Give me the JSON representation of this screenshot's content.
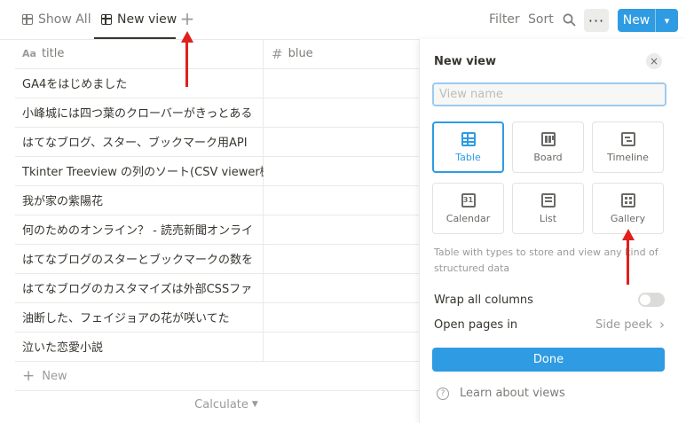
{
  "tabs": {
    "show_all": "Show All",
    "new_view": "New view",
    "add": "+"
  },
  "toolbar": {
    "filter": "Filter",
    "sort": "Sort",
    "more": "···",
    "new": "New"
  },
  "table": {
    "columns": [
      {
        "icon": "Aa",
        "label": "title"
      },
      {
        "icon": "#",
        "label": "blue"
      }
    ],
    "rows": [
      "GA4をはじめました",
      "小峰城には四つ葉のクローバーがきっとある",
      "はてなブログ、スター、ブックマーク用API",
      "Tkinter Treeview の列のソート(CSV viewer機",
      "我が家の紫陽花",
      "何のためのオンライン？ - 読売新聞オンライ",
      "はてなブログのスターとブックマークの数を",
      "はてなブログのカスタマイズは外部CSSファ",
      "油断した、フェイジョアの花が咲いてた",
      "泣いた恋愛小説"
    ],
    "new_row": "New",
    "calculate": "Calculate"
  },
  "panel": {
    "title": "New view",
    "close": "×",
    "name_placeholder": "View name",
    "layouts": [
      {
        "label": "Table",
        "icon": "table-icon",
        "selected": true
      },
      {
        "label": "Board",
        "icon": "board-icon",
        "selected": false
      },
      {
        "label": "Timeline",
        "icon": "timeline-icon",
        "selected": false
      },
      {
        "label": "Calendar",
        "icon": "calendar-icon",
        "selected": false
      },
      {
        "label": "List",
        "icon": "list-icon",
        "selected": false
      },
      {
        "label": "Gallery",
        "icon": "gallery-icon",
        "selected": false
      }
    ],
    "calendar_icon_text": "31",
    "description": "Table with types to store and view any kind of structured data",
    "wrap_label": "Wrap all columns",
    "wrap_on": false,
    "open_label": "Open pages in",
    "open_value": "Side peek",
    "done": "Done",
    "learn": "Learn about views",
    "learn_icon_text": "?"
  },
  "colors": {
    "accent": "#2e9be3",
    "annotation": "#e0201c"
  }
}
